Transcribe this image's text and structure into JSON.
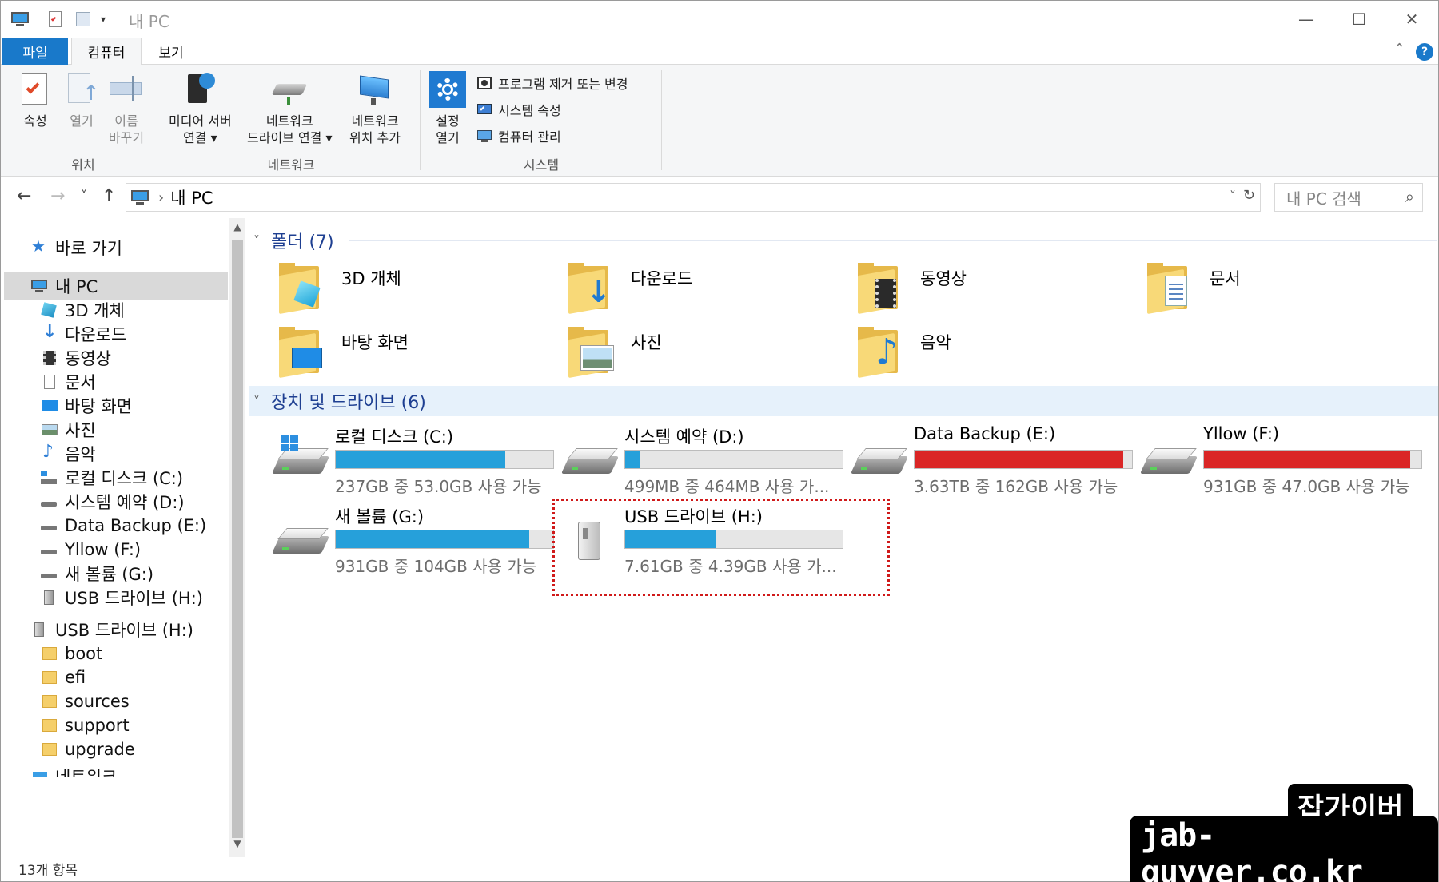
{
  "window": {
    "title": "내 PC"
  },
  "controls": {
    "minimize": "—",
    "maximize": "☐",
    "close": "✕",
    "ribbon_collapse": "⌃",
    "help": "?"
  },
  "ribbon_tabs": [
    {
      "label": "파일"
    },
    {
      "label": "컴퓨터"
    },
    {
      "label": "보기"
    }
  ],
  "ribbon": {
    "location": {
      "label": "위치",
      "properties": "속성",
      "open": "열기",
      "rename_l1": "이름",
      "rename_l2": "바꾸기"
    },
    "network": {
      "label": "네트워크",
      "media_l1": "미디어 서버",
      "media_l2": "연결 ▾",
      "map_l1": "네트워크",
      "map_l2": "드라이브 연결 ▾",
      "add_l1": "네트워크",
      "add_l2": "위치 추가"
    },
    "system": {
      "label": "시스템",
      "settings_l1": "설정",
      "settings_l2": "열기",
      "uninstall": "프로그램 제거 또는 변경",
      "properties": "시스템 속성",
      "manage": "컴퓨터 관리"
    }
  },
  "address": {
    "back": "←",
    "forward": "→",
    "recent": "˅",
    "up": "↑",
    "crumb_sep": "›",
    "path": "내 PC",
    "dropdown": "˅",
    "refresh": "↻",
    "search_placeholder": "내 PC 검색",
    "search_icon": "⌕"
  },
  "navpane": {
    "quick_access": "바로 가기",
    "this_pc": "내 PC",
    "pc_children": [
      "3D 개체",
      "다운로드",
      "동영상",
      "문서",
      "바탕 화면",
      "사진",
      "음악",
      "로컬 디스크 (C:)",
      "시스템 예약 (D:)",
      "Data Backup (E:)",
      "Yllow (F:)",
      "새 볼륨 (G:)",
      "USB 드라이브 (H:)"
    ],
    "usb_root": "USB 드라이브 (H:)",
    "usb_children": [
      "boot",
      "efi",
      "sources",
      "support",
      "upgrade"
    ],
    "network": "네트워크"
  },
  "content": {
    "folders_header": "폴더 (7)",
    "folders": [
      "3D 개체",
      "다운로드",
      "동영상",
      "문서",
      "바탕 화면",
      "사진",
      "음악"
    ],
    "drives_header": "장치 및 드라이브 (6)",
    "drives": [
      {
        "name": "로컬 디스크 (C:)",
        "size": "237GB 중 53.0GB 사용 가능",
        "used_fraction": 0.78,
        "color": "#26a0da"
      },
      {
        "name": "시스템 예약 (D:)",
        "size": "499MB 중 464MB 사용 가...",
        "used_fraction": 0.07,
        "color": "#26a0da"
      },
      {
        "name": "Data Backup (E:)",
        "size": "3.63TB 중 162GB 사용 가능",
        "used_fraction": 0.96,
        "color": "#da2626"
      },
      {
        "name": "Yllow (F:)",
        "size": "931GB 중 47.0GB 사용 가능",
        "used_fraction": 0.95,
        "color": "#da2626"
      },
      {
        "name": "새 볼륨 (G:)",
        "size": "931GB 중 104GB 사용 가능",
        "used_fraction": 0.89,
        "color": "#26a0da"
      },
      {
        "name": "USB 드라이브 (H:)",
        "size": "7.61GB 중 4.39GB 사용 가...",
        "used_fraction": 0.42,
        "color": "#26a0da"
      }
    ]
  },
  "status": {
    "item_count": "13개 항목"
  },
  "watermark": {
    "line1": "잡가이버",
    "line2": "jab-guyver.co.kr"
  }
}
